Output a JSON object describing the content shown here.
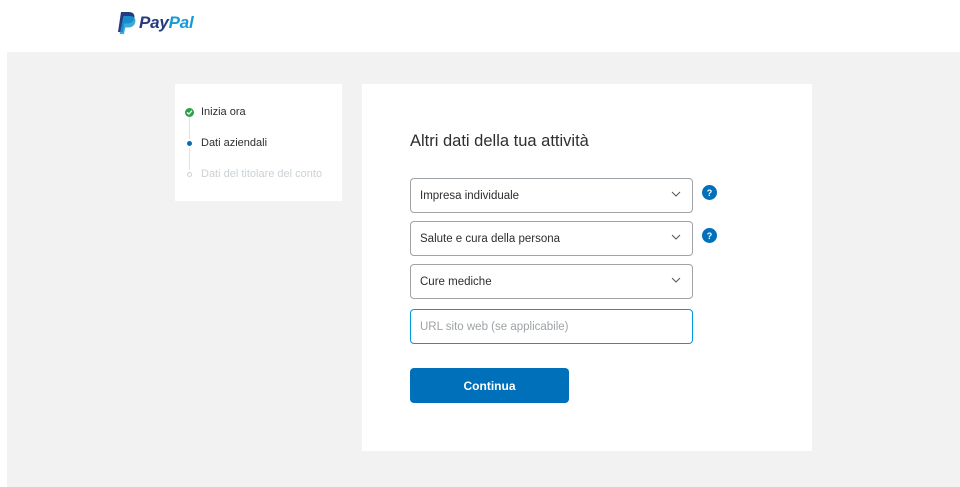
{
  "brand": {
    "name_part1": "Pay",
    "name_part2": "Pal",
    "icon": "paypal-p-logo",
    "color_dark": "#253b80",
    "color_light": "#179bd7"
  },
  "steps": [
    {
      "label": "Inizia ora",
      "status": "completed",
      "icon": "check-circle-icon"
    },
    {
      "label": "Dati aziendali",
      "status": "current",
      "icon": "dot-icon"
    },
    {
      "label": "Dati del titolare del conto",
      "status": "upcoming",
      "icon": "hollow-dot-icon"
    }
  ],
  "form": {
    "title": "Altri dati della tua attività",
    "business_type": {
      "value": "Impresa individuale",
      "help": "?"
    },
    "category": {
      "value": "Salute e cura della persona",
      "help": "?"
    },
    "subcategory": {
      "value": "Cure mediche"
    },
    "website": {
      "value": "",
      "placeholder": "URL sito web (se applicabile)"
    },
    "submit_label": "Continua"
  },
  "colors": {
    "primary": "#0070ba",
    "success": "#2ba14a",
    "page_bg": "#f2f2f2",
    "focus_border": "#009cde"
  }
}
